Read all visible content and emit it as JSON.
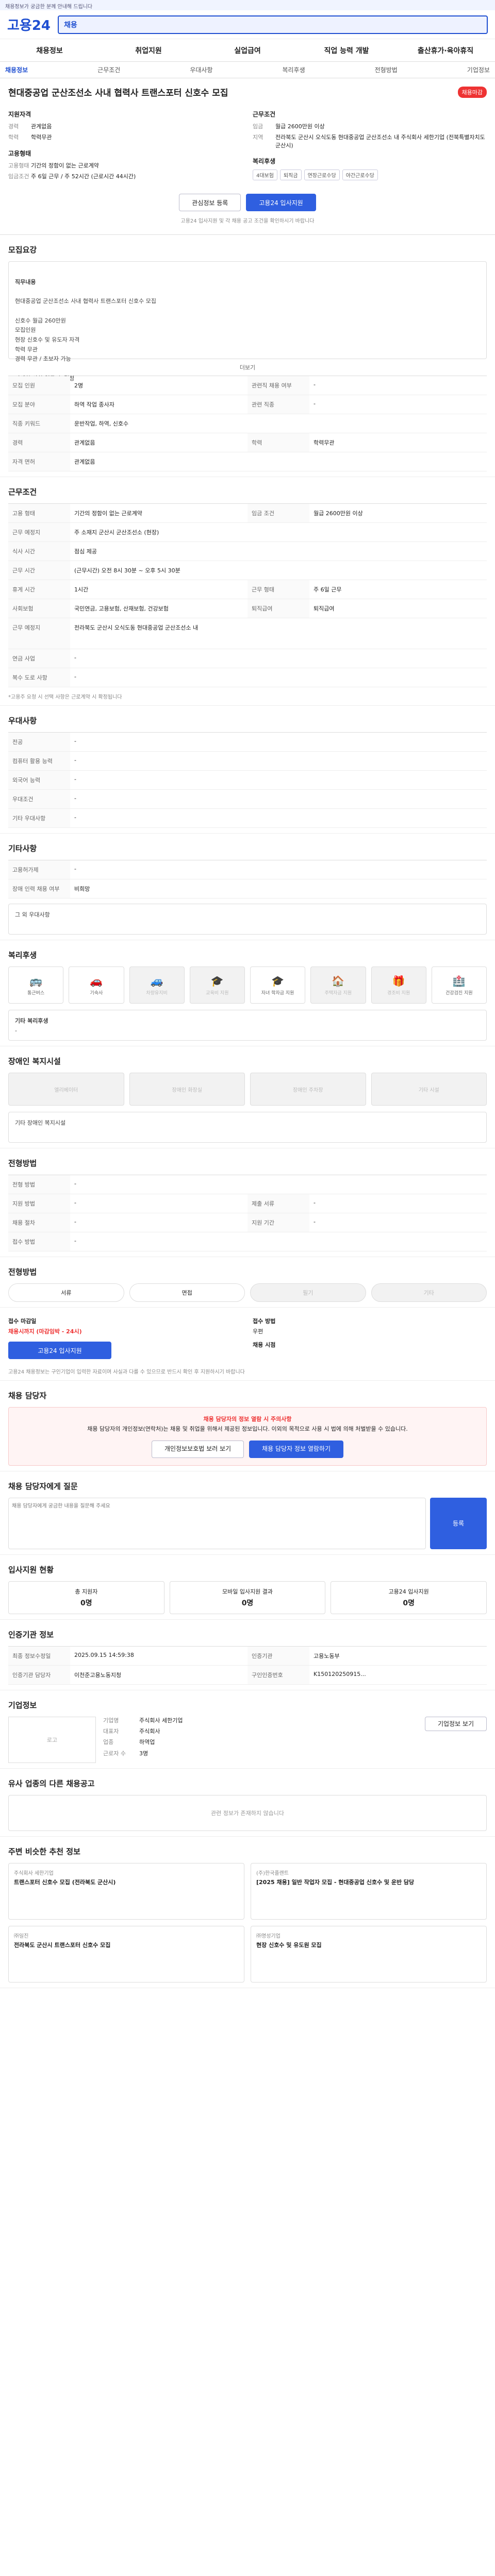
{
  "topbar": "채용정보가 궁금한 분께 안내해 드립니다",
  "brand": {
    "logo": "고용24",
    "search": "채용"
  },
  "gnb": [
    "채용정보",
    "취업지원",
    "실업급여",
    "직업 능력 개발",
    "출산휴가·육아휴직"
  ],
  "subtabs": [
    "채용정보",
    "근무조건",
    "우대사항",
    "복리후생",
    "전형방법",
    "기업정보"
  ],
  "job": {
    "title": "현대중공업 군산조선소 사내 협력사 트랜스포터 신호수 모집",
    "dday": "채용마감",
    "left_head": "지원자격",
    "left": [
      [
        "경력",
        "관계없음"
      ],
      [
        "학력",
        "학력무관"
      ]
    ],
    "left_head2": "고용형태",
    "left2": [
      [
        "고용형태",
        "기간의 정함이 없는 근로계약"
      ],
      [
        "임금조건",
        "주 6일 근무 / 주 52시간 (근로시간 44시간)"
      ]
    ],
    "right_head": "근무조건",
    "right": [
      [
        "임금",
        "월급 2600만원 이상"
      ],
      [
        "지역",
        "전라북도 군산시 오식도동 현대중공업 군산조선소 내 주식회사 세한기업 (전북특별자치도 군산시)"
      ]
    ],
    "right_head2": "복리후생",
    "tags": [
      "4대보험",
      "퇴직금",
      "연장근로수당",
      "야간근로수당"
    ],
    "btn_scrap": "관심정보 등록",
    "btn_apply": "고용24 입사지원",
    "note": "고용24 입사지원 및 각 채용 공고 조건을 확인하시기 바랍니다"
  },
  "detail": {
    "title": "모집요강",
    "label": "직무내용",
    "text": "현대중공업 군산조선소 사내 협력사 트랜스포터 신호수 모집\n\n신호수 월급 260만원\n모집인원\n현장 신호수 및 유도자 자격\n학력 무관\n경력 무관 / 초보자 가능\n\n자세한 사항 업무 후 결정",
    "more": "더보기"
  },
  "info_grid": [
    [
      "모집 인원",
      "2명",
      "관련직 채용 여부",
      "-"
    ],
    [
      "모집 분야",
      "하역 작업 종사자",
      "관련 직종",
      "-"
    ],
    [
      "직종 키워드",
      "운반작업, 하역, 신호수",
      "",
      ""
    ],
    [
      "경력",
      "관계없음",
      "학력",
      "학력무관"
    ],
    [
      "자격 면허",
      "관계없음",
      "",
      ""
    ]
  ],
  "work": {
    "title": "근무조건",
    "grid": [
      [
        "고용 형태",
        "기간의 정함이 없는 근로계약",
        "임금 조건",
        "월급 2600만원 이상"
      ],
      [
        "근무 예정지",
        "주 소재지 군산시 군산조선소 (현장)",
        "",
        ""
      ],
      [
        "식사 시간",
        "점심 제공",
        "",
        ""
      ],
      [
        "근무 시간",
        "(근무시간) 오전 8시 30분 ~ 오후 5시 30분",
        "",
        ""
      ],
      [
        "휴게 시간",
        "1시간",
        "근무 형태",
        "주 6일 근무"
      ],
      [
        "사회보험",
        "국민연금, 고용보험, 산재보험, 건강보험",
        "퇴직급여",
        "퇴직급여"
      ],
      [
        "근무 예정지",
        "전라북도 군산시 오식도동 현대중공업 군산조선소 내",
        "",
        ""
      ],
      [
        "연금 사업",
        "-",
        "",
        ""
      ],
      [
        "복수 도로 사항",
        "-",
        "",
        ""
      ]
    ],
    "note": "*고용주 요청 시 선택 사항은 근로계약 시 확정됩니다"
  },
  "pref": {
    "title": "우대사항",
    "rows": [
      [
        "전공",
        "-"
      ],
      [
        "컴퓨터 활용 능력",
        "-"
      ],
      [
        "외국어 능력",
        "-"
      ],
      [
        "우대조건",
        "-"
      ],
      [
        "기타 우대사항",
        "-"
      ]
    ]
  },
  "etc": {
    "title": "기타사항",
    "rows": [
      [
        "고용허가제",
        "-"
      ],
      [
        "장애 인력 채용 여부",
        "비희망"
      ]
    ],
    "extra": "그 외 우대사항"
  },
  "benefit": {
    "title": "복리후생",
    "items": [
      [
        "통근버스",
        "🚌",
        false
      ],
      [
        "기숙사",
        "🚗",
        false
      ],
      [
        "차량유지비",
        "🚙",
        true
      ],
      [
        "교육비 지원",
        "🎓",
        true
      ],
      [
        "자녀 학자금 지원",
        "🎓",
        false
      ],
      [
        "주택자금 지원",
        "🏠",
        true
      ],
      [
        "경조비 지원",
        "🎁",
        true
      ],
      [
        "건강검진 지원",
        "🏥",
        false
      ]
    ],
    "other": "기타 복리후생",
    "other_val": "-"
  },
  "disability": {
    "title": "장애인 복지시설",
    "items": [
      "엘리베이터",
      "장애인 화장실",
      "장애인 주차장",
      "기타 시설"
    ],
    "other": "기타 장애인 복지시설"
  },
  "hire": {
    "title": "전형방법",
    "rows": [
      [
        "전형 방법",
        "-"
      ],
      [
        "지원 방법",
        "-",
        "제출 서류",
        "-"
      ],
      [
        "채용 절차",
        "-",
        "지원 기간",
        "-"
      ],
      [
        "접수 방법",
        "-"
      ]
    ]
  },
  "selection": {
    "title": "전형방법",
    "pills": [
      "서류",
      "면접",
      "필기",
      "기타"
    ]
  },
  "receive": {
    "title": "접수 마감일",
    "deadline": "채용시까지 (마감임박 - 24시)",
    "method": "접수 방법",
    "method_val": "우편",
    "extra": "채용 시점",
    "apply": "고용24 입사지원"
  },
  "warn": "고용24 채용정보는 구인기업이 입력한 자료이며 사실과 다를 수 있으므로 반드시 확인 후 지원하시기 바랍니다",
  "contact": {
    "title": "채용 담당자",
    "alert_title": "채용 담당자의 정보 열람 시 주의사항",
    "alert_text": "채용 담당자의 개인정보(연락처)는 채용 및 취업을 위해서 제공된 정보입니다. 이외의 목적으로 사용 시 법에 의해 처벌받을 수 있습니다.",
    "btn1": "개인정보보호법 보러 보기",
    "btn2": "채용 담당자 정보 열람하기"
  },
  "qa": {
    "title": "채용 담당자에게 질문",
    "placeholder": "채용 담당자에게 궁금한 내용을 질문해 주세요",
    "send": "등록"
  },
  "apply_stat": {
    "title": "입사지원 현황",
    "items": [
      [
        "총 지원자",
        "0명"
      ],
      [
        "모바일 입사지원 결과",
        "0명"
      ],
      [
        "고용24 입사지원",
        "0명"
      ]
    ]
  },
  "recruit_info": {
    "title": "인증기관 정보",
    "rows": [
      [
        "최종 정보수정일",
        "2025.09.15 14:59:38",
        "인증기관",
        "고용노동부"
      ],
      [
        "인증기관 담당자",
        "이천준고용노동지청",
        "구인인증번호",
        "K150120250915..."
      ]
    ]
  },
  "company": {
    "title": "기업정보",
    "logo": "로고",
    "rows": [
      [
        "기업명",
        "주식회사 세한기업"
      ],
      [
        "대표자",
        "주식회사"
      ],
      [
        "업종",
        "하역업"
      ],
      [
        "근로자 수",
        "3명"
      ]
    ],
    "btn": "기업정보 보기"
  },
  "related": {
    "title": "유사 업종의 다른 채용공고",
    "empty": "관련 정보가 존재하지 않습니다"
  },
  "nearby": {
    "title": "주변 비슷한 추천 정보",
    "cards": [
      [
        "주식회사 세한기업",
        "트랜스포터 신호수 모집 (전라북도 군산시)"
      ],
      [
        "(주)한국플랜트",
        "[2025 채용] 일반 작업자 모집 - 현대중공업 신호수 및 운반 담당"
      ],
      [
        "㈜일진",
        "전라북도 군산시 트랜스포터 신호수 모집"
      ],
      [
        "㈜명성기업",
        "현장 신호수 및 유도원 모집"
      ]
    ]
  }
}
